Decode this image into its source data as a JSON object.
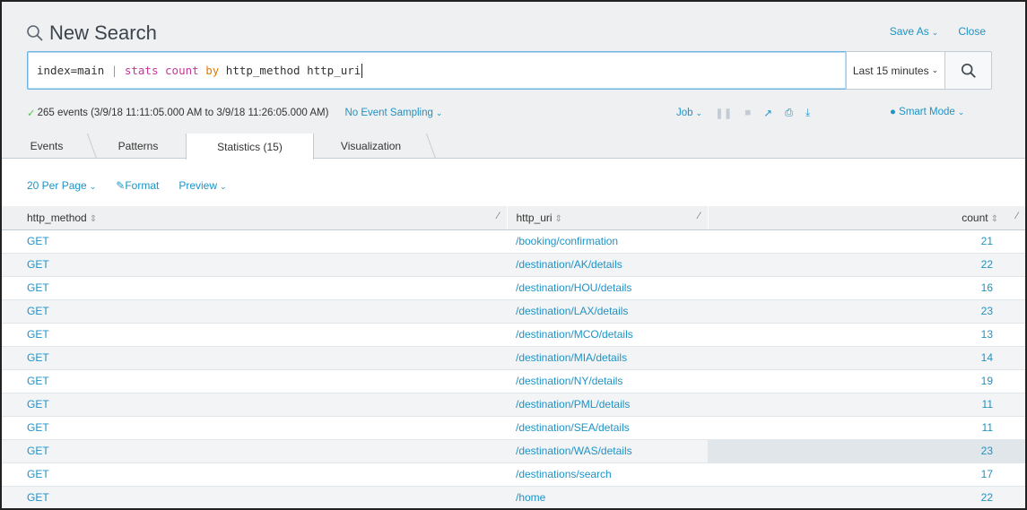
{
  "header": {
    "title": "New Search",
    "save_as": "Save As",
    "close": "Close"
  },
  "search": {
    "query_parts": {
      "index": "index=main",
      "pipe": "|",
      "command": "stats",
      "function": "count",
      "by": "by",
      "fields": "http_method http_uri"
    },
    "time_range": "Last 15 minutes"
  },
  "status": {
    "events": "265 events (3/9/18 11:11:05.000 AM to 3/9/18 11:26:05.000 AM)",
    "sampling": "No Event Sampling",
    "job": "Job",
    "smart_mode": "Smart Mode"
  },
  "tabs": [
    {
      "label": "Events"
    },
    {
      "label": "Patterns"
    },
    {
      "label": "Statistics (15)"
    },
    {
      "label": "Visualization"
    }
  ],
  "toolbar": {
    "per_page": "20 Per Page",
    "format": "Format",
    "preview": "Preview"
  },
  "table": {
    "columns": [
      "http_method",
      "http_uri",
      "count"
    ],
    "rows": [
      {
        "method": "GET",
        "uri": "/booking/confirmation",
        "count": "21"
      },
      {
        "method": "GET",
        "uri": "/destination/AK/details",
        "count": "22"
      },
      {
        "method": "GET",
        "uri": "/destination/HOU/details",
        "count": "16"
      },
      {
        "method": "GET",
        "uri": "/destination/LAX/details",
        "count": "23"
      },
      {
        "method": "GET",
        "uri": "/destination/MCO/details",
        "count": "13"
      },
      {
        "method": "GET",
        "uri": "/destination/MIA/details",
        "count": "14"
      },
      {
        "method": "GET",
        "uri": "/destination/NY/details",
        "count": "19"
      },
      {
        "method": "GET",
        "uri": "/destination/PML/details",
        "count": "11"
      },
      {
        "method": "GET",
        "uri": "/destination/SEA/details",
        "count": "11"
      },
      {
        "method": "GET",
        "uri": "/destination/WAS/details",
        "count": "23"
      },
      {
        "method": "GET",
        "uri": "/destinations/search",
        "count": "17"
      },
      {
        "method": "GET",
        "uri": "/home",
        "count": "22"
      }
    ]
  },
  "colors": {
    "link": "#1e93c6",
    "header_bg": "#eef0f1",
    "command": "#c0389a",
    "keyword": "#e07b00"
  }
}
